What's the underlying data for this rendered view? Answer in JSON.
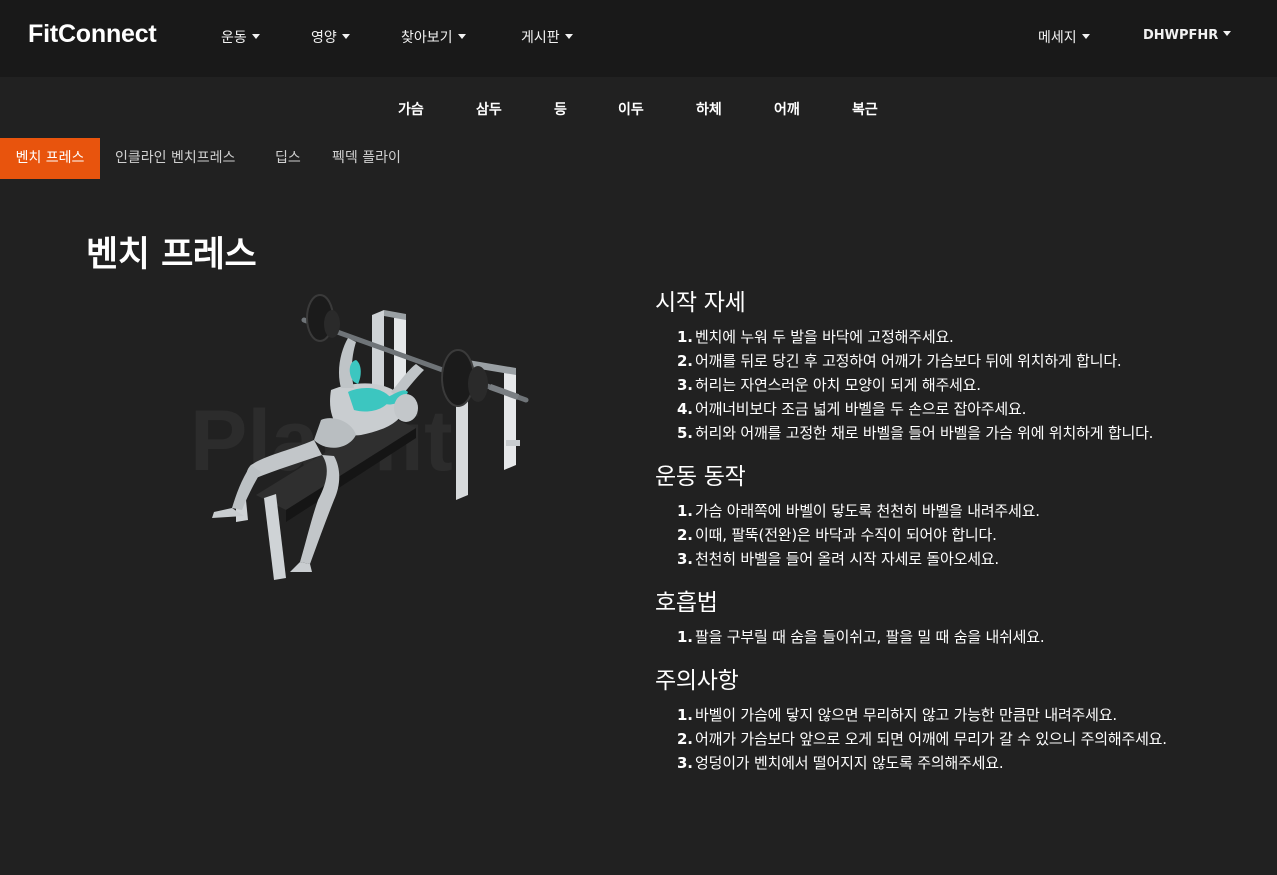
{
  "navbar": {
    "brand": "FitConnect",
    "menus": [
      "운동",
      "영양",
      "찾아보기",
      "게시판"
    ],
    "messages": "메세지",
    "user": "DHWPFHR"
  },
  "categories": [
    "가슴",
    "삼두",
    "등",
    "이두",
    "하체",
    "어깨",
    "복근"
  ],
  "exercise_tabs": {
    "active": "벤치 프레스",
    "others": [
      "인클라인 벤치프레스",
      "딥스",
      "펙덱 플라이"
    ]
  },
  "page_title": "벤치 프레스",
  "illustration": {
    "watermark": "Planfit",
    "accent_color": "#3cc6c0"
  },
  "sections": [
    {
      "title": "시작 자세",
      "steps": [
        "벤치에 누워 두 발을 바닥에 고정해주세요.",
        "어깨를 뒤로 당긴 후 고정하여 어깨가 가슴보다 뒤에 위치하게 합니다.",
        "허리는 자연스러운 아치 모양이 되게 해주세요.",
        "어깨너비보다 조금 넓게 바벨을 두 손으로 잡아주세요.",
        "허리와 어깨를 고정한 채로 바벨을 들어 바벨을 가슴 위에 위치하게 합니다."
      ]
    },
    {
      "title": "운동 동작",
      "steps": [
        "가슴 아래쪽에 바벨이 닿도록 천천히 바벨을 내려주세요.",
        "이때, 팔뚝(전완)은 바닥과 수직이 되어야 합니다.",
        "천천히 바벨을 들어 올려 시작 자세로 돌아오세요."
      ]
    },
    {
      "title": "호흡법",
      "steps": [
        "팔을 구부릴 때 숨을 들이쉬고, 팔을 밀 때 숨을 내쉬세요."
      ]
    },
    {
      "title": "주의사항",
      "steps": [
        "바벨이 가슴에 닿지 않으면 무리하지 않고 가능한 만큼만 내려주세요.",
        "어깨가 가슴보다 앞으로 오게 되면 어깨에 무리가 갈 수 있으니 주의해주세요.",
        "엉덩이가 벤치에서 떨어지지 않도록 주의해주세요."
      ]
    }
  ],
  "colors": {
    "background": "#212121",
    "navbar": "#191919",
    "active_tab": "#e8540d"
  }
}
